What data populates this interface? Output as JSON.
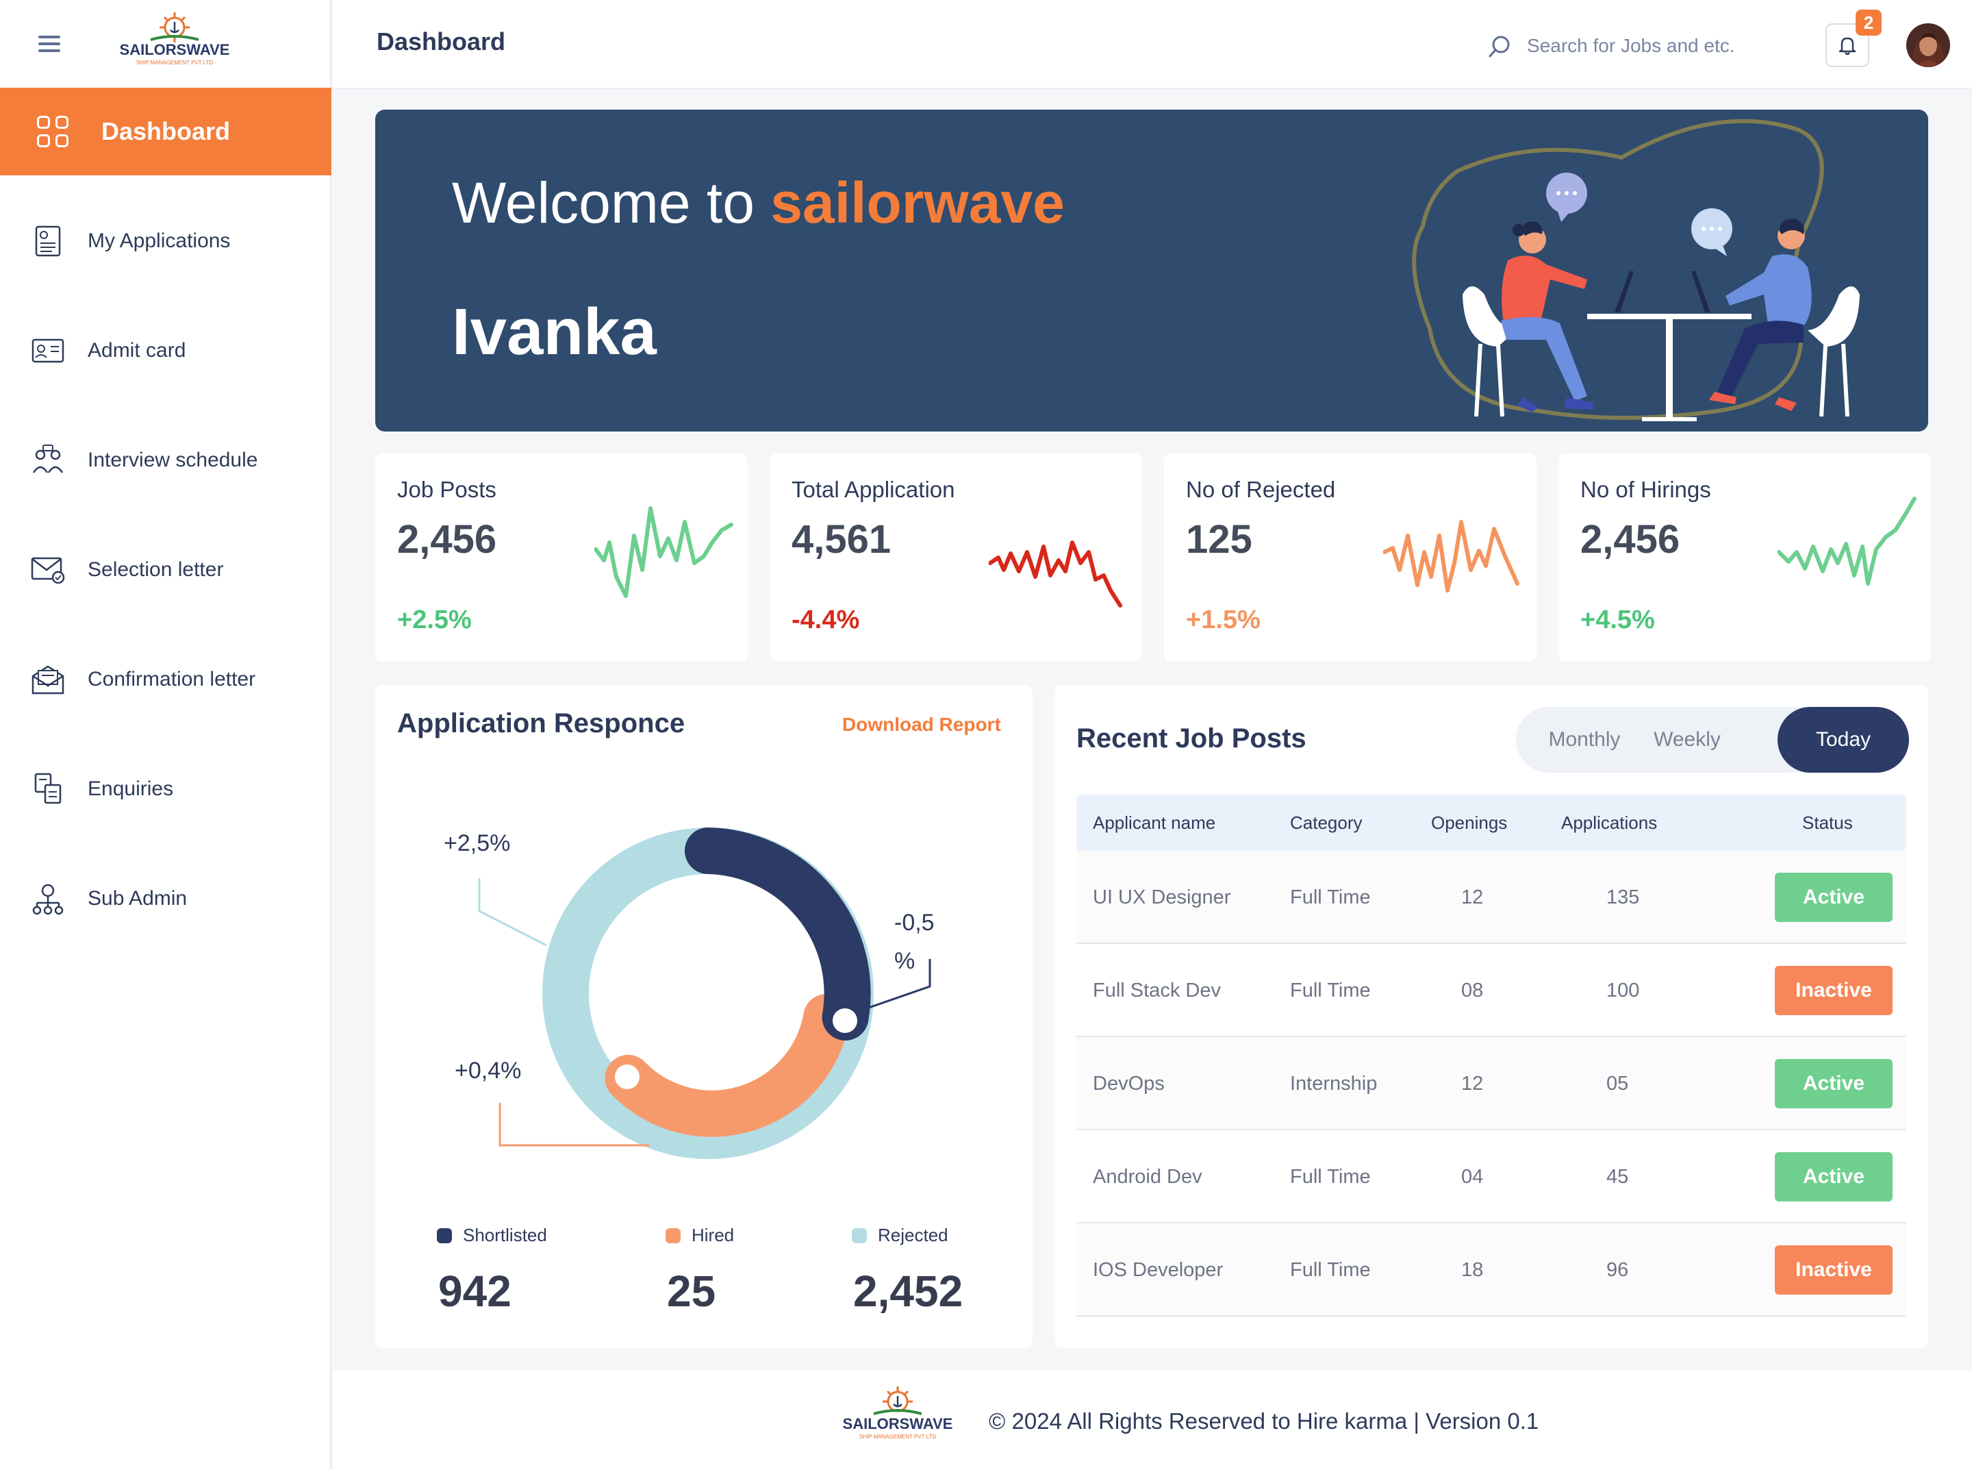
{
  "sidebar": {
    "logo_text": "SAILORSWAVE",
    "logo_subtext": "SHIP MANAGEMENT PVT LTD",
    "active": {
      "label": "Dashboard",
      "icon": "dashboard-grid-icon"
    },
    "items": [
      {
        "label": "My Applications",
        "icon": "document-icon"
      },
      {
        "label": "Admit card",
        "icon": "id-card-icon"
      },
      {
        "label": "Interview schedule",
        "icon": "interview-icon"
      },
      {
        "label": "Selection letter",
        "icon": "mail-check-icon"
      },
      {
        "label": "Confirmation letter",
        "icon": "letter-icon"
      },
      {
        "label": "Enquiries",
        "icon": "enquiry-icon"
      },
      {
        "label": "Sub Admin",
        "icon": "network-icon"
      }
    ]
  },
  "header": {
    "title": "Dashboard",
    "search_placeholder": "Search for Jobs and etc.",
    "notification_count": "2"
  },
  "banner": {
    "welcome": "Welcome to",
    "brand": "sailorwave",
    "username": "Ivanka"
  },
  "stats": [
    {
      "title": "Job Posts",
      "value": "2,456",
      "change": "+2.5%",
      "color": "#4cc47a"
    },
    {
      "title": "Total Application",
      "value": "4,561",
      "change": "-4.4%",
      "color": "#d8281a"
    },
    {
      "title": "No of Rejected",
      "value": "125",
      "change": "+1.5%",
      "color": "#f4955f"
    },
    {
      "title": "No of Hirings",
      "value": "2,456",
      "change": "+4.5%",
      "color": "#4cc47a"
    }
  ],
  "response": {
    "title": "Application Responce",
    "download": "Download Report",
    "callouts": {
      "rejected": "+2,5%",
      "shortlisted_a": "-0,5",
      "shortlisted_b": "%",
      "hired": "+0,4%"
    },
    "legend": [
      {
        "label": "Shortlisted",
        "value": "942",
        "color": "#2c3a66"
      },
      {
        "label": "Hired",
        "value": "25",
        "color": "#f79a6b"
      },
      {
        "label": "Rejected",
        "value": "2,452",
        "color": "#b3dde3"
      }
    ]
  },
  "jobs": {
    "title": "Recent Job Posts",
    "tabs": [
      "Monthly",
      "Weekly",
      "Today"
    ],
    "columns": [
      "Applicant name",
      "Category",
      "Openings",
      "Applications",
      "Status"
    ],
    "rows": [
      {
        "name": "UI UX Designer",
        "category": "Full Time",
        "openings": "12",
        "applications": "135",
        "status": "Active"
      },
      {
        "name": "Full Stack Dev",
        "category": "Full Time",
        "openings": "08",
        "applications": "100",
        "status": "Inactive"
      },
      {
        "name": "DevOps",
        "category": "Internship",
        "openings": "12",
        "applications": "05",
        "status": "Active"
      },
      {
        "name": "Android Dev",
        "category": "Full Time",
        "openings": "04",
        "applications": "45",
        "status": "Active"
      },
      {
        "name": "IOS Developer",
        "category": "Full Time",
        "openings": "18",
        "applications": "96",
        "status": "Inactive"
      }
    ],
    "status_colors": {
      "Active": "#6fcf8f",
      "Inactive": "#f7875a"
    }
  },
  "footer": {
    "copyright": "© 2024 All Rights Reserved to Hire karma | Version 0.1"
  }
}
